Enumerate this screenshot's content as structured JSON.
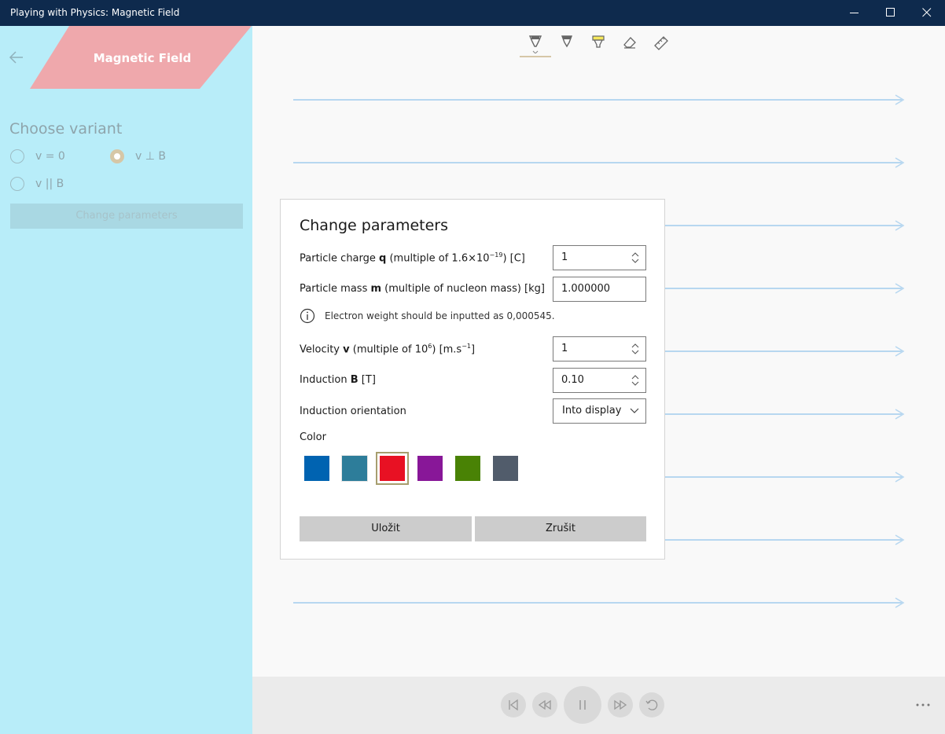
{
  "window": {
    "title": "Playing with Physics: Magnetic Field"
  },
  "sidebar": {
    "banner_title": "Magnetic Field",
    "choose_label": "Choose variant",
    "variants": [
      {
        "label": "v = 0",
        "checked": false
      },
      {
        "label": "v ⊥ B",
        "checked": true
      },
      {
        "label": "v || B",
        "checked": false
      }
    ],
    "change_button_label": "Change parameters"
  },
  "toolbar": {
    "tools": [
      "ballpoint-pen-icon",
      "pencil-icon",
      "highlighter-icon",
      "eraser-icon",
      "ruler-icon"
    ],
    "selected_tool": "ballpoint-pen-icon"
  },
  "canvas": {
    "field_line_color": "#b7d7f0"
  },
  "dialog": {
    "title": "Change parameters",
    "charge": {
      "label_pre": "Particle charge ",
      "label_bold": "q",
      "label_post": " (multiple of 1.6×10",
      "label_sup": "−19",
      "label_end": ") [C]",
      "value": "1"
    },
    "mass": {
      "label_pre": "Particle mass ",
      "label_bold": "m",
      "label_post": " (multiple of nucleon mass) [kg]",
      "value": "1.000000"
    },
    "info_text": "Electron weight should be inputted as 0,000545.",
    "velocity": {
      "label_pre": "Velocity ",
      "label_bold": "v",
      "label_post": " (multiple of 10",
      "label_sup": "6",
      "label_mid": ") [m.s",
      "label_sup2": "−1",
      "label_end": "]",
      "value": "1"
    },
    "induction": {
      "label_pre": "Induction ",
      "label_bold": "B",
      "label_post": " [T]",
      "value": "0.10"
    },
    "orientation": {
      "label": "Induction orientation",
      "value": "Into display"
    },
    "color_label": "Color",
    "colors": [
      "#0063b1",
      "#2d7d9a",
      "#e81123",
      "#881798",
      "#498205",
      "#515c6b"
    ],
    "selected_color": "#e81123",
    "save_label": "Uložit",
    "cancel_label": "Zrušit"
  },
  "playback": {
    "buttons": [
      "skip-back-icon",
      "rewind-icon",
      "pause-icon",
      "fast-forward-icon",
      "replay-icon"
    ]
  }
}
